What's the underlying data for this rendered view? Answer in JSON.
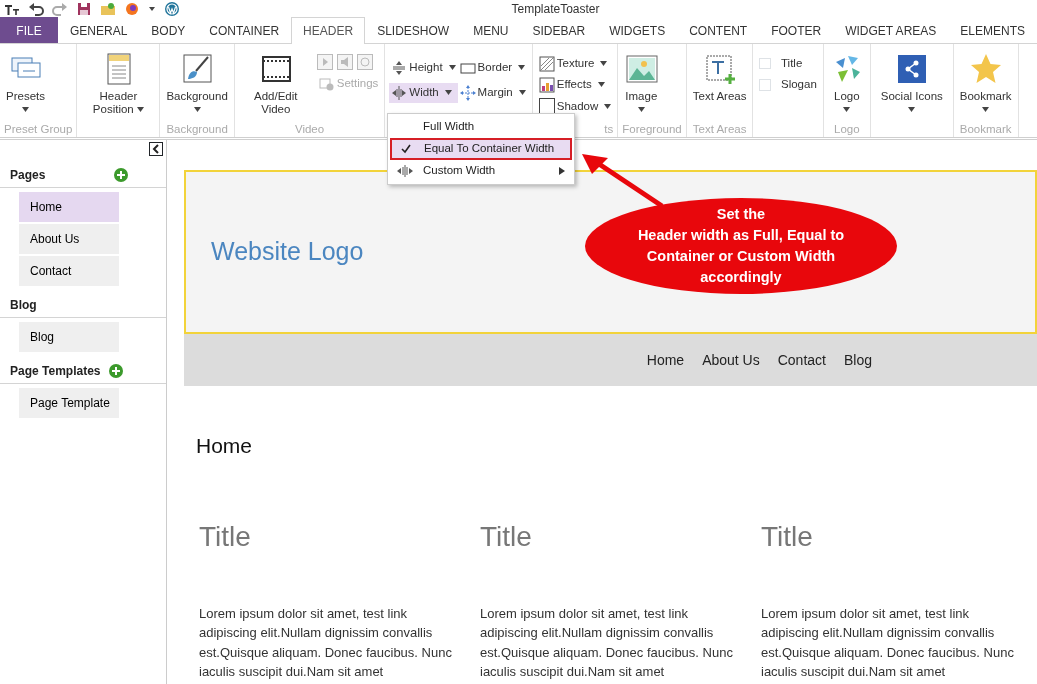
{
  "window": {
    "title": "TemplateToaster"
  },
  "tabs": [
    {
      "label": "FILE",
      "kind": "file",
      "selected": false
    },
    {
      "label": "GENERAL",
      "kind": "tab",
      "selected": false
    },
    {
      "label": "BODY",
      "kind": "tab",
      "selected": false
    },
    {
      "label": "CONTAINER",
      "kind": "tab",
      "selected": false
    },
    {
      "label": "HEADER",
      "kind": "tab",
      "selected": true
    },
    {
      "label": "SLIDESHOW",
      "kind": "tab",
      "selected": false
    },
    {
      "label": "MENU",
      "kind": "tab",
      "selected": false
    },
    {
      "label": "SIDEBAR",
      "kind": "tab",
      "selected": false
    },
    {
      "label": "WIDGETS",
      "kind": "tab",
      "selected": false
    },
    {
      "label": "CONTENT",
      "kind": "tab",
      "selected": false
    },
    {
      "label": "FOOTER",
      "kind": "tab",
      "selected": false
    },
    {
      "label": "WIDGET AREAS",
      "kind": "tab",
      "selected": false
    },
    {
      "label": "ELEMENTS",
      "kind": "tab",
      "selected": false
    }
  ],
  "ribbon": [
    {
      "label": "Preset Group",
      "items": [
        {
          "kind": "large",
          "label": "Presets",
          "dropdown": true
        }
      ]
    },
    {
      "items": [
        {
          "kind": "large",
          "label": "Header Position",
          "dropdown": true
        }
      ]
    },
    {
      "label": "Background",
      "items": [
        {
          "kind": "large",
          "label": "Background",
          "dropdown": true
        }
      ]
    },
    {
      "label": "Video",
      "items": [
        {
          "kind": "large",
          "label": "Add/Edit Video",
          "dropdown": false
        },
        {
          "kind": "media",
          "label": "Settings",
          "disabled": true
        }
      ]
    },
    {
      "items": [
        {
          "kind": "small",
          "label": "Height",
          "dropdown": true,
          "open": false
        },
        {
          "kind": "small",
          "label": "Border",
          "dropdown": true,
          "open": false
        },
        {
          "kind": "small",
          "label": "Width",
          "dropdown": true,
          "open": true
        },
        {
          "kind": "small",
          "label": "Margin",
          "dropdown": true,
          "open": false
        }
      ]
    },
    {
      "label": "ts",
      "items": [
        {
          "kind": "small",
          "label": "Texture",
          "dropdown": true,
          "open": false
        },
        {
          "kind": "small",
          "label": "Effects",
          "dropdown": true,
          "open": false
        },
        {
          "kind": "small",
          "label": "Shadow",
          "dropdown": true,
          "open": false
        }
      ]
    },
    {
      "label": "Foreground",
      "items": [
        {
          "kind": "large",
          "label": "Image",
          "dropdown": true
        }
      ]
    },
    {
      "label": "Text Areas",
      "items": [
        {
          "kind": "large",
          "label": "Text Areas",
          "dropdown": false
        }
      ]
    },
    {
      "items": [
        {
          "kind": "check",
          "label": "Title",
          "checked": false
        },
        {
          "kind": "check",
          "label": "Slogan",
          "checked": false
        }
      ]
    },
    {
      "label": "Logo",
      "items": [
        {
          "kind": "large",
          "label": "Logo",
          "dropdown": true
        }
      ]
    },
    {
      "items": [
        {
          "kind": "large",
          "label": "Social Icons",
          "dropdown": true
        }
      ]
    },
    {
      "label": "Bookmark",
      "items": [
        {
          "kind": "large",
          "label": "Bookmark",
          "dropdown": true
        }
      ]
    }
  ],
  "width_menu": [
    {
      "label": "Full Width",
      "checked": false,
      "selected": false,
      "submenu": false
    },
    {
      "label": "Equal To Container Width",
      "checked": true,
      "selected": true,
      "submenu": false
    },
    {
      "label": "Custom Width",
      "checked": false,
      "selected": false,
      "submenu": true
    }
  ],
  "sidebar": [
    {
      "title": "Pages",
      "add": true,
      "items": [
        {
          "label": "Home",
          "selected": true
        },
        {
          "label": "About Us",
          "selected": false
        },
        {
          "label": "Contact",
          "selected": false
        }
      ]
    },
    {
      "title": "Blog",
      "add": false,
      "items": [
        {
          "label": "Blog",
          "selected": false
        }
      ]
    },
    {
      "title": "Page Templates",
      "add": true,
      "items": [
        {
          "label": "Page Template",
          "selected": false
        }
      ]
    }
  ],
  "preview": {
    "logo": "Website Logo",
    "nav": [
      "Home",
      "About Us",
      "Contact",
      "Blog"
    ],
    "heading": "Home",
    "columns": [
      {
        "title": "Title",
        "text": "Lorem ipsum dolor sit amet, test link adipiscing elit.Nullam dignissim convallis est.Quisque aliquam. Donec faucibus. Nunc iaculis suscipit dui.Nam sit amet"
      },
      {
        "title": "Title",
        "text": "Lorem ipsum dolor sit amet, test link adipiscing elit.Nullam dignissim convallis est.Quisque aliquam. Donec faucibus. Nunc iaculis suscipit dui.Nam sit amet"
      },
      {
        "title": "Title",
        "text": "Lorem ipsum dolor sit amet, test link adipiscing elit.Nullam dignissim convallis est.Quisque aliquam. Donec faucibus. Nunc iaculis suscipit dui.Nam sit amet"
      }
    ]
  },
  "callout": "Set the\nHeader width as Full, Equal to\nContainer or Custom Width\naccordingly"
}
